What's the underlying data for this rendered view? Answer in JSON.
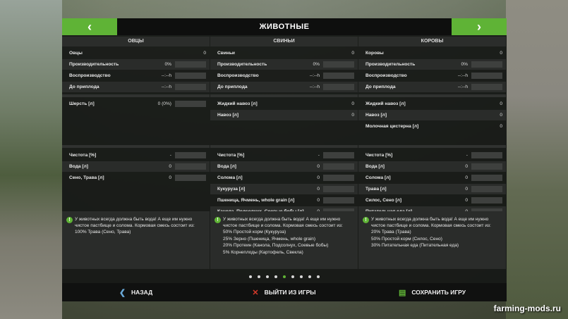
{
  "header": {
    "title": "ЖИВОТНЫЕ",
    "prev_icon": "chevron-left-icon",
    "next_icon": "chevron-right-icon"
  },
  "columns": [
    {
      "title": "ОВЦЫ",
      "stats": [
        {
          "label": "Овцы",
          "value": "0",
          "bar": false
        },
        {
          "label": "Производительность",
          "value": "0%",
          "bar": true,
          "level": 0
        },
        {
          "label": "Воспроизводство",
          "value": "--:--h",
          "bar": true,
          "level": 0
        },
        {
          "label": "До приплода",
          "value": "--:--h",
          "bar": true,
          "level": 0
        }
      ],
      "products": [
        {
          "label": "Шерсть [л]",
          "value": "0 (0%)",
          "bar": true,
          "level": 0
        }
      ],
      "feed": [
        {
          "label": "Чистота [%]",
          "value": "-",
          "bar": true,
          "level": 0
        },
        {
          "label": "Вода [л]",
          "value": "0",
          "bar": true,
          "level": 0
        },
        {
          "label": "Сено, Трава [л]",
          "value": "0",
          "bar": true,
          "level": 0
        }
      ],
      "info": {
        "text": "У животных всегда должна быть вода! А еще им нужно чистое пастбище и солома. Кормовая смесь состоит из:",
        "mix": [
          "100% Трава (Сено, Трава)"
        ]
      }
    },
    {
      "title": "СВИНЬИ",
      "stats": [
        {
          "label": "Свиньи",
          "value": "0",
          "bar": false
        },
        {
          "label": "Производительность",
          "value": "0%",
          "bar": true,
          "level": 0
        },
        {
          "label": "Воспроизводство",
          "value": "--:--h",
          "bar": true,
          "level": 0
        },
        {
          "label": "До приплода",
          "value": "--:--h",
          "bar": true,
          "level": 0
        }
      ],
      "products": [
        {
          "label": "Жидкий навоз [л]",
          "value": "0",
          "bar": false
        },
        {
          "label": "Навоз [л]",
          "value": "0",
          "bar": false
        }
      ],
      "feed": [
        {
          "label": "Чистота [%]",
          "value": "-",
          "bar": true,
          "level": 0
        },
        {
          "label": "Вода [л]",
          "value": "0",
          "bar": true,
          "level": 0
        },
        {
          "label": "Солома [л]",
          "value": "0",
          "bar": true,
          "level": 0
        },
        {
          "label": "Кукуруза [л]",
          "value": "0",
          "bar": true,
          "level": 0
        },
        {
          "label": "Пшеница, Ячмень, whole grain [л]",
          "value": "0",
          "bar": true,
          "level": 0
        },
        {
          "label": "Канола, Подсолнух, Соевые бобы [л]",
          "value": "0",
          "bar": true,
          "level": 0
        },
        {
          "label": "Картофель, Свекла [л]",
          "value": "0",
          "bar": true,
          "level": 0
        }
      ],
      "info": {
        "text": "У животных всегда должна быть вода! А еще им нужно чистое пастбище и солома. Кормовая смесь состоит из:",
        "mix": [
          "50% Простой корм (Кукуруза)",
          "25% Зерно (Пшеница, Ячмень, whole grain)",
          "20% Протеин (Канола, Подсолнух, Соевые бобы)",
          "5% Корнеплоды (Картофель, Свекла)"
        ]
      }
    },
    {
      "title": "КОРОВЫ",
      "stats": [
        {
          "label": "Коровы",
          "value": "0",
          "bar": false
        },
        {
          "label": "Производительность",
          "value": "0%",
          "bar": true,
          "level": 0
        },
        {
          "label": "Воспроизводство",
          "value": "--:--h",
          "bar": true,
          "level": 0
        },
        {
          "label": "До приплода",
          "value": "--:--h",
          "bar": true,
          "level": 0
        }
      ],
      "products": [
        {
          "label": "Жидкий навоз [л]",
          "value": "0",
          "bar": false
        },
        {
          "label": "Навоз [л]",
          "value": "0",
          "bar": false
        },
        {
          "label": "Молочная цистерна [л]",
          "value": "0",
          "bar": false
        }
      ],
      "feed": [
        {
          "label": "Чистота [%]",
          "value": "-",
          "bar": true,
          "level": 0
        },
        {
          "label": "Вода [л]",
          "value": "0",
          "bar": true,
          "level": 0
        },
        {
          "label": "Солома [л]",
          "value": "0",
          "bar": true,
          "level": 0
        },
        {
          "label": "Трава [л]",
          "value": "0",
          "bar": true,
          "level": 0
        },
        {
          "label": "Силос, Сено [л]",
          "value": "0",
          "bar": true,
          "level": 0
        },
        {
          "label": "Питательная еда [л]",
          "value": "0",
          "bar": true,
          "level": 0
        }
      ],
      "info": {
        "text": "У животных всегда должна быть вода! А еще им нужно чистое пастбище и солома. Кормовая смесь состоит из:",
        "mix": [
          "20% Трава (Трава)",
          "50% Простой корм (Силос, Сено)",
          "30% Питательная еда (Питательная еда)"
        ]
      }
    }
  ],
  "pagination": {
    "pages": 9,
    "active_index": 4
  },
  "footer": {
    "back": {
      "label": "НАЗАД",
      "icon": "back-arrow-icon"
    },
    "quit": {
      "label": "ВЫЙТИ ИЗ ИГРЫ",
      "icon": "close-x-icon"
    },
    "save": {
      "label": "СОХРАНИТЬ ИГРУ",
      "icon": "save-icon"
    }
  },
  "watermark": "farming-mods.ru",
  "colors": {
    "accent": "#5fb336",
    "panel": "#161816",
    "quit": "#d63a2a",
    "back": "#6aa9d8"
  }
}
